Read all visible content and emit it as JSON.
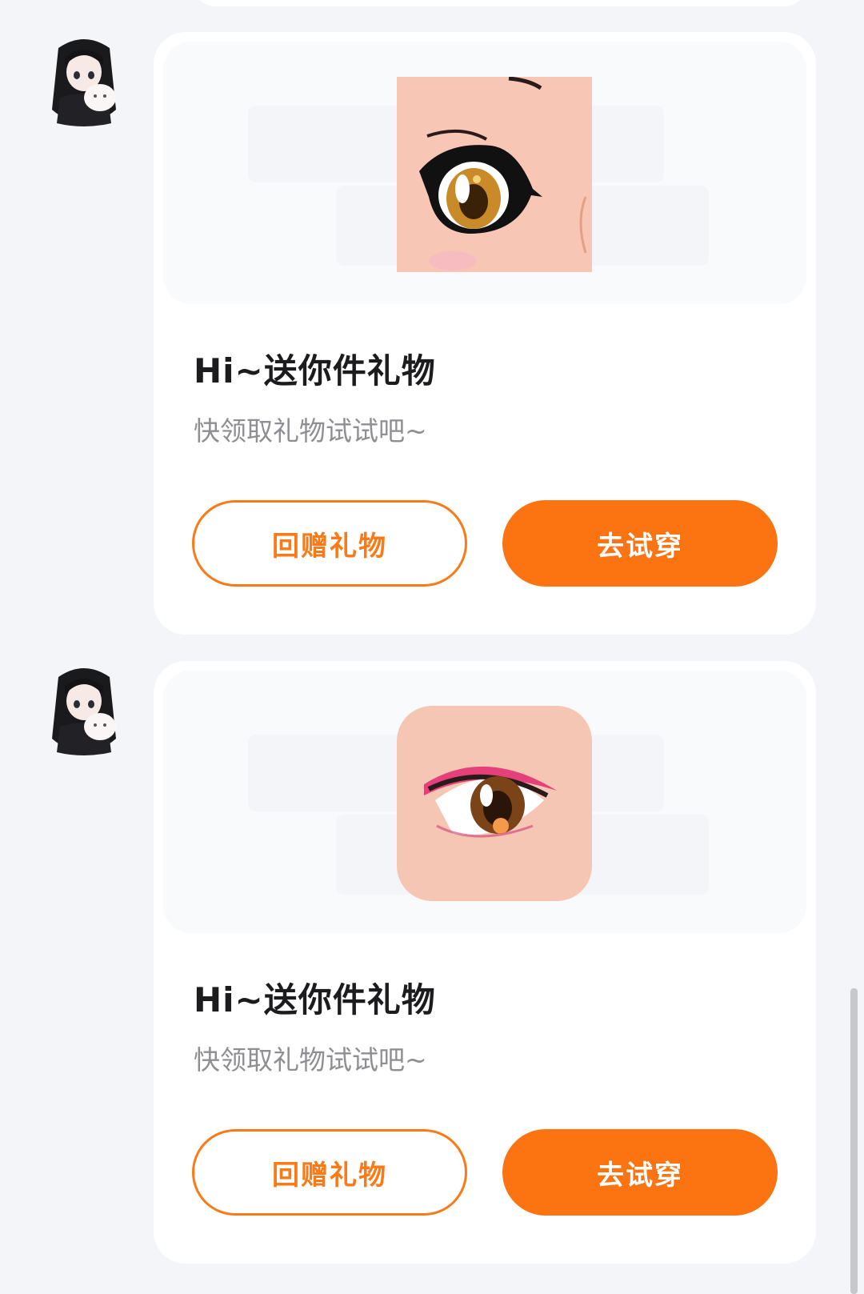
{
  "colors": {
    "background": "#f4f5f9",
    "card": "#ffffff",
    "accent": "#fb7411",
    "title": "#1c1c1e",
    "subtitle": "#8e8e93"
  },
  "messages": [
    {
      "avatar_icon": "anime-girl-avatar",
      "item_icon": "anime-eye-makeup-yellow",
      "title": "Hi~送你件礼物",
      "subtitle": "快领取礼物试试吧~",
      "return_gift_label": "回赠礼物",
      "try_on_label": "去试穿"
    },
    {
      "avatar_icon": "anime-girl-avatar",
      "item_icon": "anime-eye-makeup-pink",
      "title": "Hi~送你件礼物",
      "subtitle": "快领取礼物试试吧~",
      "return_gift_label": "回赠礼物",
      "try_on_label": "去试穿"
    }
  ]
}
